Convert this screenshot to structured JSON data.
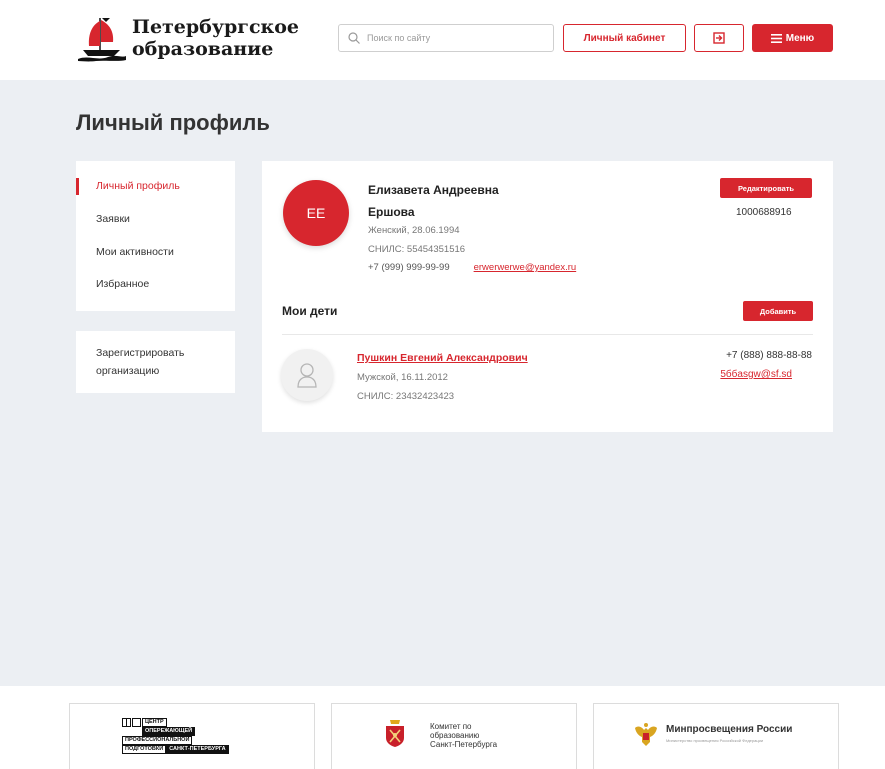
{
  "header": {
    "logo_line1": "Петербургское",
    "logo_line2": "образование",
    "search_placeholder": "Поиск по сайту",
    "cabinet_label": "Личный кабинет",
    "menu_label": "Меню"
  },
  "colors": {
    "accent": "#d7262e",
    "background": "#eceff3"
  },
  "page": {
    "title": "Личный профиль"
  },
  "sidebar": {
    "items": [
      {
        "label": "Личный профиль",
        "active": true
      },
      {
        "label": "Заявки"
      },
      {
        "label": "Мои активности"
      },
      {
        "label": "Избранное"
      }
    ],
    "register_line1": "Зарегистрировать",
    "register_line2": "организацию"
  },
  "profile": {
    "initials": "ЕЕ",
    "name_line1": "Елизавета Андреевна",
    "name_line2": "Ершова",
    "gender_birth": "Женский, 28.06.1994",
    "snils": "СНИЛС: 55454351516",
    "phone": "+7 (999) 999-99-99",
    "email": "erwerwerwe@yandex.ru",
    "edit_label": "Редактировать",
    "id": "1000688916"
  },
  "children": {
    "title": "Мои дети",
    "add_label": "Добавить",
    "items": [
      {
        "name": "Пушкин Евгений Александрович",
        "gender_birth": "Мужской, 16.11.2012",
        "snils": "СНИЛС: 23432423423",
        "phone": "+7 (888) 888-88-88",
        "email": "5ббasgw@sf.sd"
      }
    ]
  },
  "footer": {
    "partners": [
      {
        "lines": [
          "ЦЕНТР",
          "ОПЕРЕЖАЮЩЕЙ",
          "ПРОФЕССИОНАЛЬНОЙ",
          "ПОДГОТОВКИ",
          "САНКТ-ПЕТЕРБУРГА"
        ]
      },
      {
        "lines": [
          "Комитет по",
          "образованию",
          "Санкт-Петербурга"
        ]
      },
      {
        "title": "Минпросвещения России",
        "subtitle": "Министерство просвещения Российской Федерации"
      }
    ]
  }
}
